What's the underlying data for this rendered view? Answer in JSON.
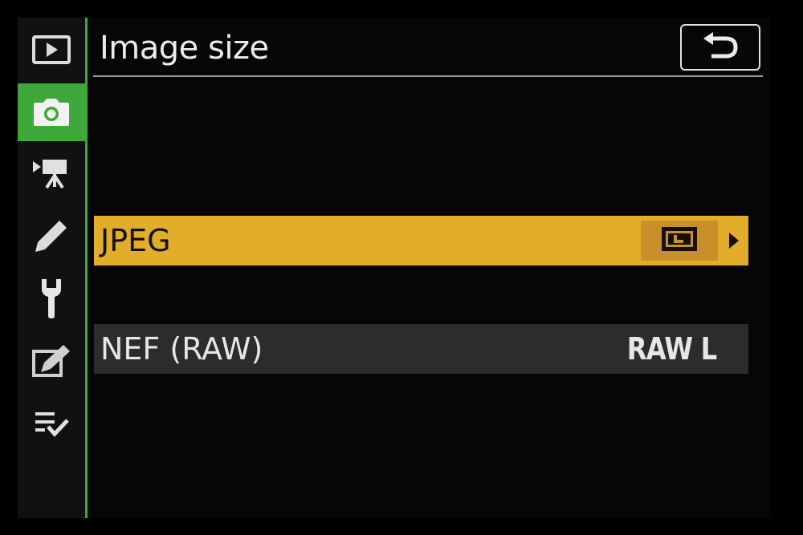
{
  "menu": {
    "title": "Image size",
    "back_icon": "back-return-icon"
  },
  "sidebar": {
    "items": [
      {
        "name": "playback-menu",
        "icon": "playback-icon",
        "active": false
      },
      {
        "name": "photo-shooting-menu",
        "icon": "camera-icon",
        "active": true
      },
      {
        "name": "movie-shooting-menu",
        "icon": "movie-camera-icon",
        "active": false
      },
      {
        "name": "custom-settings-menu",
        "icon": "pencil-icon",
        "active": false
      },
      {
        "name": "setup-menu",
        "icon": "wrench-icon",
        "active": false
      },
      {
        "name": "retouch-menu",
        "icon": "retouch-icon",
        "active": false
      },
      {
        "name": "my-menu",
        "icon": "my-menu-icon",
        "active": false
      }
    ]
  },
  "rows": [
    {
      "label": "JPEG",
      "value_icon": "size-large-icon",
      "has_arrow": true,
      "selected": true
    },
    {
      "label": "NEF (RAW)",
      "value": "RAW L",
      "selected": false
    }
  ],
  "colors": {
    "accent_green": "#3fa83a",
    "highlight_yellow": "#e2ad2a",
    "value_box_orange": "#c98f2a",
    "row_gray": "#2c2c2c"
  }
}
